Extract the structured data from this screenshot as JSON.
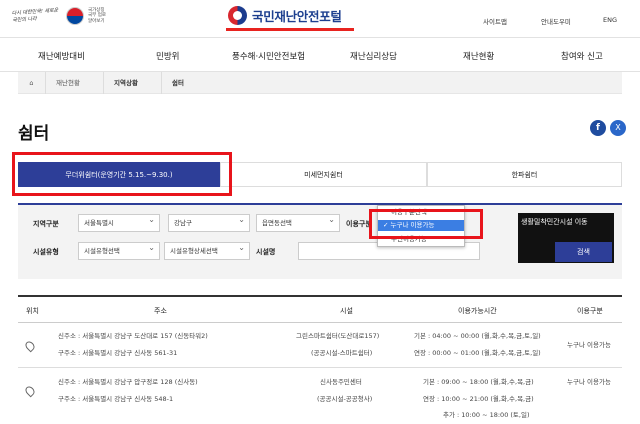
{
  "header": {
    "gov_slogan": "다시 대한민국! 새로운 국민의 나라",
    "gov_mini": "국가상징 국부 업로 알아보기",
    "brand_title": "국민재난안전포털",
    "util": [
      "사이트맵",
      "안내도우미",
      "ENG"
    ]
  },
  "nav": [
    "재난예방대비",
    "민방위",
    "풍수해·시민안전보험",
    "재난심리상담",
    "재난현황",
    "참여와 신고"
  ],
  "breadcrumb": [
    "재난현황",
    "지역상황",
    "쉼터"
  ],
  "page_title": "쉼터",
  "share": {
    "facebook": "f",
    "x": "X"
  },
  "tabs": [
    {
      "label": "무더위쉼터(운영기간 5.15.~9.30.)",
      "active": true
    },
    {
      "label": "미세먼지쉼터",
      "active": false
    },
    {
      "label": "한파쉼터",
      "active": false
    }
  ],
  "search": {
    "region_label": "지역구분",
    "sido": "서울특별시",
    "sigungu": "강남구",
    "dong": "읍면동선택",
    "usage_label": "이용구분",
    "usage_options": [
      "이용구분선택",
      "누구나 이용가능",
      "주민이용가능"
    ],
    "usage_selected": "누구나 이용가능",
    "type_label": "시설유형",
    "type": "시설유형선택",
    "type_detail": "시설유형상세선택",
    "name_label": "시설명",
    "promo_text": "생활밀착민간시설 이동",
    "search_button": "검색"
  },
  "table": {
    "headers": [
      "위치",
      "주소",
      "시설",
      "이용가능시간",
      "이용구분"
    ],
    "rows": [
      {
        "addr_new": "신주소 : 서울특별시 강남구 도산대로 157 (신동타워2)",
        "addr_old": "구주소 : 서울특별시 강남구 신사동 561-31",
        "facility": "그린스마트쉼터(도산대로157)",
        "facility_type": "(공공시설-스마트쉼터)",
        "hours": [
          "기본 : 04:00 ~ 00:00 (월,화,수,목,금,토,일)",
          "연장 : 00:00 ~ 01:00 (월,화,수,목,금,토,일)"
        ],
        "usage": "누구나 이용가능"
      },
      {
        "addr_new": "신주소 : 서울특별시 강남구 압구정로 128 (신사동)",
        "addr_old": "구주소 : 서울특별시 강남구 신사동 548-1",
        "facility": "신사동주민센터",
        "facility_type": "(공공시설-공공청사)",
        "hours": [
          "기본 : 09:00 ~ 18:00 (월,화,수,목,금)",
          "연장 : 10:00 ~ 21:00 (월,화,수,목,금)",
          "추가 : 10:00 ~ 18:00 (토,일)"
        ],
        "usage": "누구나 이용가능"
      }
    ]
  },
  "colors": {
    "brand": "#2d3e98",
    "highlight": "#e8141b",
    "accent_red": "#e8231f"
  }
}
